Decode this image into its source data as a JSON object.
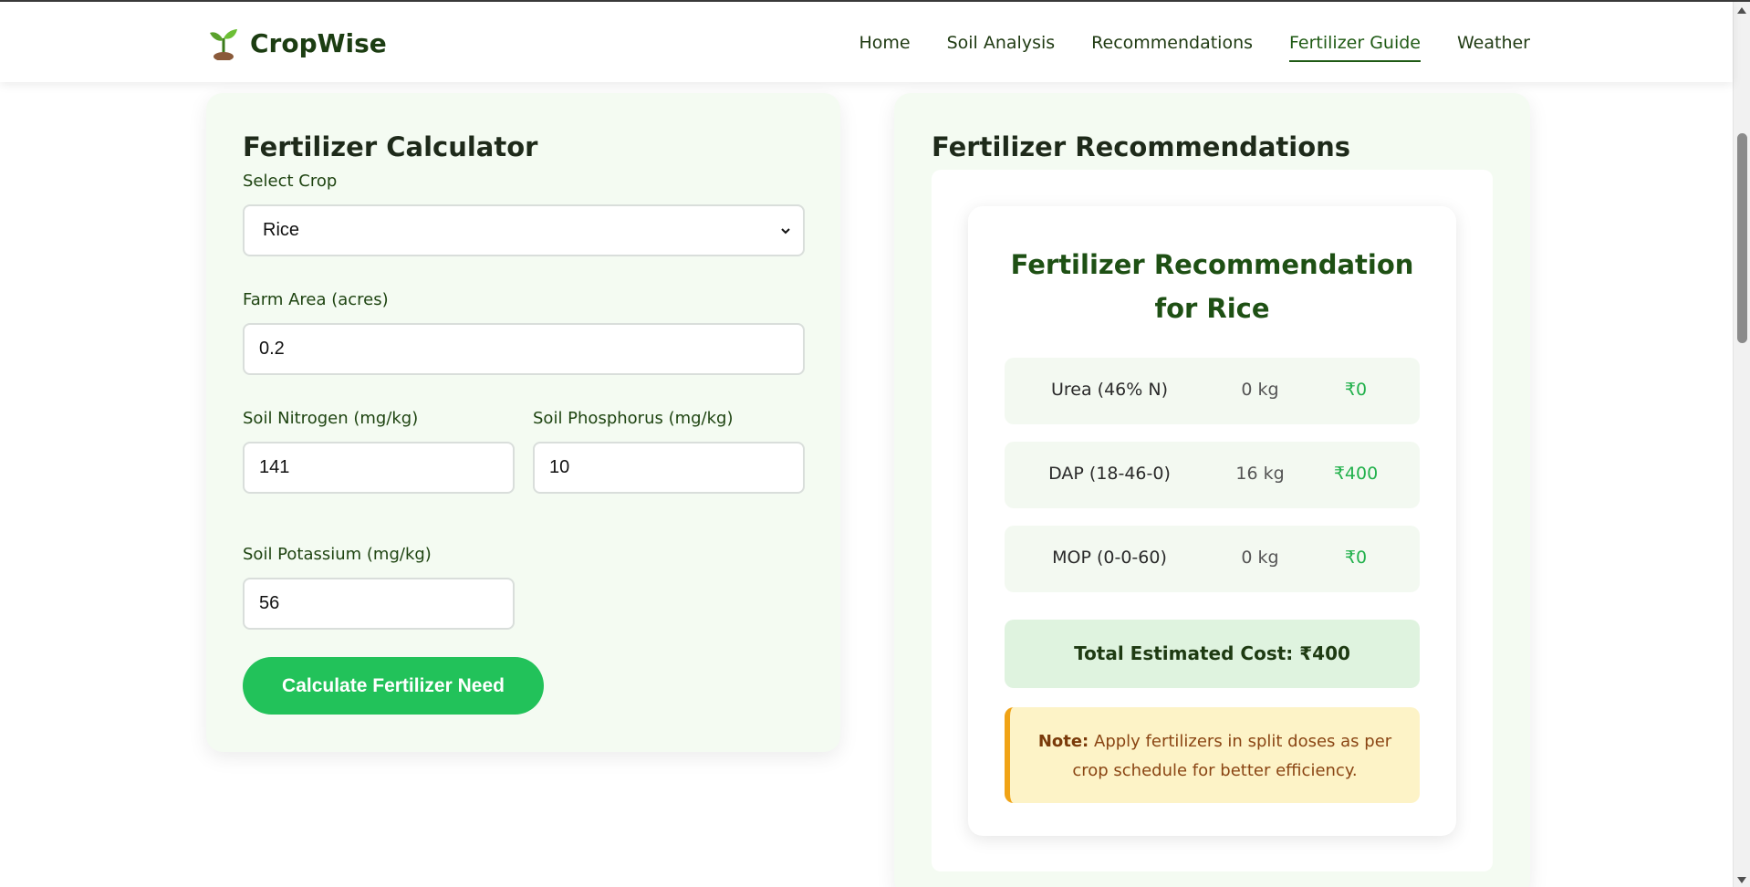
{
  "header": {
    "brand": "CropWise",
    "nav": [
      {
        "label": "Home",
        "active": false
      },
      {
        "label": "Soil Analysis",
        "active": false
      },
      {
        "label": "Recommendations",
        "active": false
      },
      {
        "label": "Fertilizer Guide",
        "active": true
      },
      {
        "label": "Weather",
        "active": false
      }
    ]
  },
  "calculator": {
    "title": "Fertilizer Calculator",
    "crop_label": "Select Crop",
    "crop_value": "Rice",
    "area_label": "Farm Area (acres)",
    "area_value": "0.2",
    "nitrogen_label": "Soil Nitrogen (mg/kg)",
    "nitrogen_value": "141",
    "phosphorus_label": "Soil Phosphorus (mg/kg)",
    "phosphorus_value": "10",
    "potassium_label": "Soil Potassium (mg/kg)",
    "potassium_value": "56",
    "button_label": "Calculate Fertilizer Need"
  },
  "recommendations": {
    "title": "Fertilizer Recommendations",
    "card_title": "Fertilizer Recommendation for Rice",
    "rows": [
      {
        "name": "Urea (46% N)",
        "qty": "0 kg",
        "cost": "₹0"
      },
      {
        "name": "DAP (18-46-0)",
        "qty": "16 kg",
        "cost": "₹400"
      },
      {
        "name": "MOP (0-0-60)",
        "qty": "0 kg",
        "cost": "₹0"
      }
    ],
    "total": "Total Estimated Cost: ₹400",
    "note_label": "Note:",
    "note_text": "Apply fertilizers in split doses as per crop schedule for better efficiency."
  },
  "colors": {
    "accent_green": "#22c25a",
    "dark_green": "#1e5014",
    "cost_green": "#22b14c",
    "note_border": "#f0a316"
  },
  "icons": {
    "brand": "sprout-icon",
    "select": "chevron-down-icon"
  }
}
